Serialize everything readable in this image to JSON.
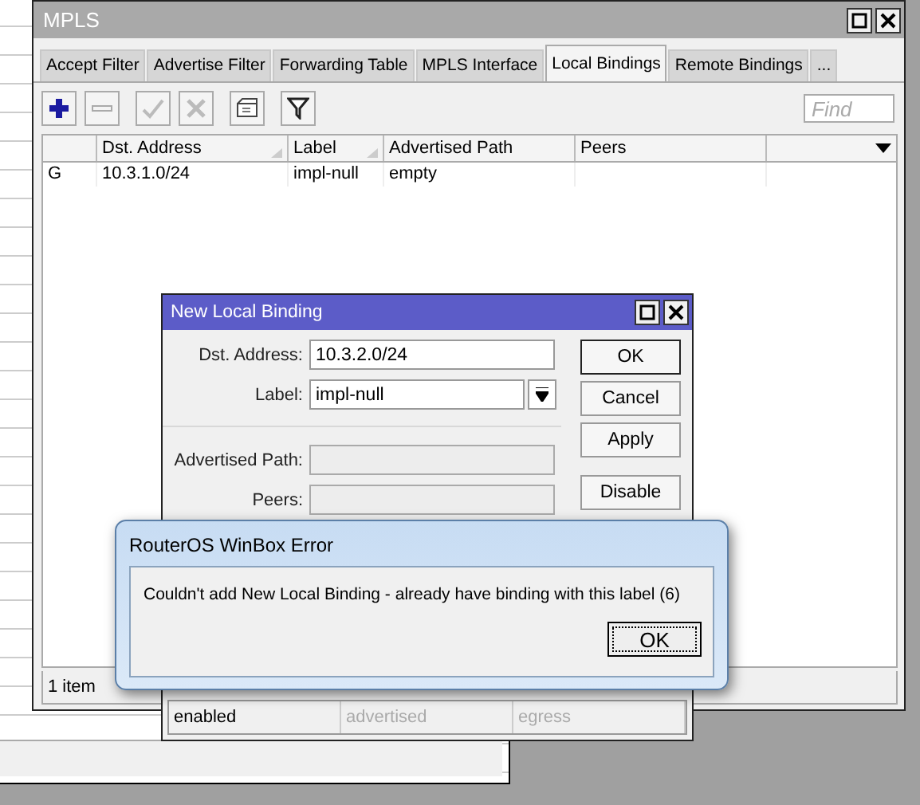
{
  "main_window": {
    "title": "MPLS",
    "active": false
  },
  "tabs": [
    {
      "label": "Accept Filter",
      "selected": false
    },
    {
      "label": "Advertise Filter",
      "selected": false
    },
    {
      "label": "Forwarding Table",
      "selected": false
    },
    {
      "label": "MPLS Interface",
      "selected": false
    },
    {
      "label": "Local Bindings",
      "selected": true
    },
    {
      "label": "Remote Bindings",
      "selected": false
    },
    {
      "label": "...",
      "selected": false
    }
  ],
  "toolbar": [
    {
      "kind": "add",
      "disabled": false
    },
    {
      "kind": "remove",
      "disabled": true
    },
    {
      "kind": "enable",
      "disabled": true
    },
    {
      "kind": "disable",
      "disabled": true
    },
    {
      "kind": "comment",
      "disabled": false
    },
    {
      "kind": "filter",
      "disabled": false
    }
  ],
  "search": {
    "placeholder": "Find"
  },
  "table": {
    "columns": [
      {
        "label": "Dst. Address",
        "sortable": true
      },
      {
        "label": "Label",
        "sortable": true
      },
      {
        "label": "Advertised Path",
        "sortable": false
      },
      {
        "label": "Peers",
        "sortable": false
      }
    ],
    "rows": [
      {
        "flag": "G",
        "cells": [
          "10.3.1.0/24",
          "impl-null",
          "empty"
        ]
      }
    ]
  },
  "status_bar": "1 item",
  "binding_dialog": {
    "title": "New Local Binding",
    "fields": [
      {
        "kind": "text",
        "label": "Dst. Address:",
        "value": "10.3.2.0/24",
        "disabled": false
      },
      {
        "kind": "combo",
        "label": "Label:",
        "value": "impl-null",
        "disabled": false
      },
      {
        "kind": "text",
        "label": "Advertised Path:",
        "disabled": true
      },
      {
        "kind": "text",
        "label": "Peers:",
        "disabled": true
      }
    ],
    "buttons": [
      {
        "label": "OK",
        "default": true
      },
      {
        "label": "Cancel",
        "default": false
      },
      {
        "label": "Apply",
        "default": false
      },
      {
        "label": "Disable",
        "default": false
      }
    ],
    "status": [
      {
        "text": "enabled",
        "disabled": false
      },
      {
        "text": "advertised",
        "disabled": true
      },
      {
        "text": "egress",
        "disabled": true
      }
    ]
  },
  "error_dialog": {
    "title": "RouterOS WinBox Error",
    "message": "Couldn't add New Local Binding - already have binding with this label (6)",
    "button": "OK"
  }
}
